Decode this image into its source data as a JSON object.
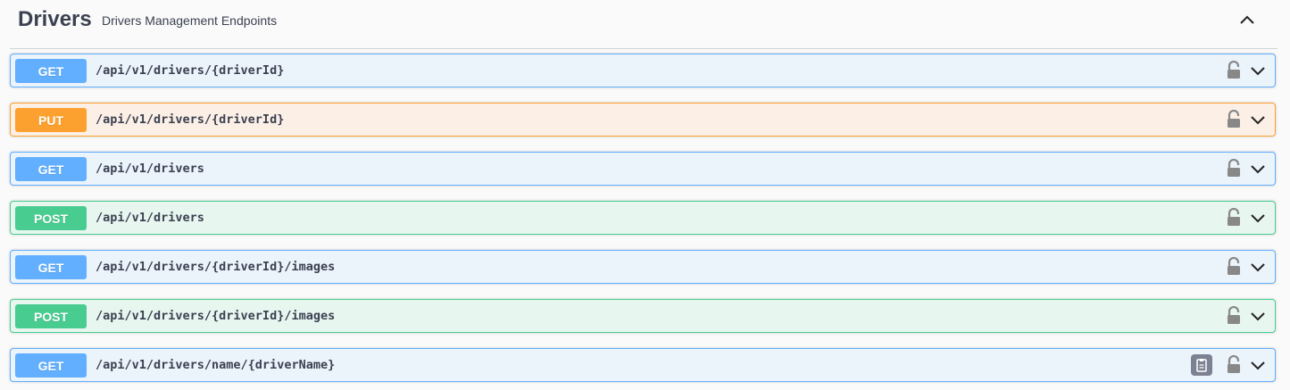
{
  "section": {
    "title": "Drivers",
    "description": "Drivers Management Endpoints"
  },
  "operations": [
    {
      "method": "GET",
      "path": "/api/v1/drivers/{driverId}"
    },
    {
      "method": "PUT",
      "path": "/api/v1/drivers/{driverId}"
    },
    {
      "method": "GET",
      "path": "/api/v1/drivers"
    },
    {
      "method": "POST",
      "path": "/api/v1/drivers"
    },
    {
      "method": "GET",
      "path": "/api/v1/drivers/{driverId}/images"
    },
    {
      "method": "POST",
      "path": "/api/v1/drivers/{driverId}/images"
    },
    {
      "method": "GET",
      "path": "/api/v1/drivers/name/{driverName}"
    }
  ],
  "colors": {
    "get": "#61affe",
    "put": "#fca130",
    "post": "#49cc90"
  },
  "icons": {
    "collapse": "chevron-up-icon",
    "lock": "lock-icon",
    "expand": "chevron-down-icon",
    "copy": "copy-to-clipboard-icon"
  }
}
